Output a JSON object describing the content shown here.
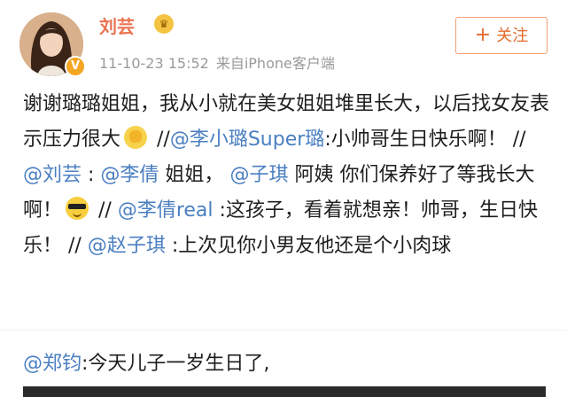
{
  "post": {
    "author": "刘芸",
    "timestamp": "11-10-23 15:52",
    "source": "来自iPhone客户端",
    "follow_label": "关注",
    "follow_icon": "plus-icon",
    "verified_icon": "verified-v-icon",
    "badge_icon": "member-badge-icon"
  },
  "content": {
    "t1": "谢谢璐璐姐姐，我从小就在美女姐姐堆里长大，以后找女友表示压力很大",
    "s1": " //",
    "m1": "@李小璐Super璐",
    "t2": ":小帅哥生日快乐啊！ // ",
    "m2": "@刘芸",
    "t3": " : ",
    "m3": "@李倩",
    "t4": " 姐姐， ",
    "m4": "@子琪",
    "t5": " 阿姨 你们保养好了等我长大啊！",
    "s2": " // ",
    "m5": "@李倩real",
    "t6": " :这孩子，看着就想亲！帅哥，生日快乐！ // ",
    "m6": "@赵子琪",
    "t7": " :上次见你小男友他还是个小肉球"
  },
  "original": {
    "mention": "@郑钧",
    "text": ":今天儿子一岁生日了,"
  },
  "colors": {
    "username": "#eb7350",
    "mention": "#4a7fc1",
    "meta": "#9a9a9a",
    "follow_border": "#f0a070"
  }
}
